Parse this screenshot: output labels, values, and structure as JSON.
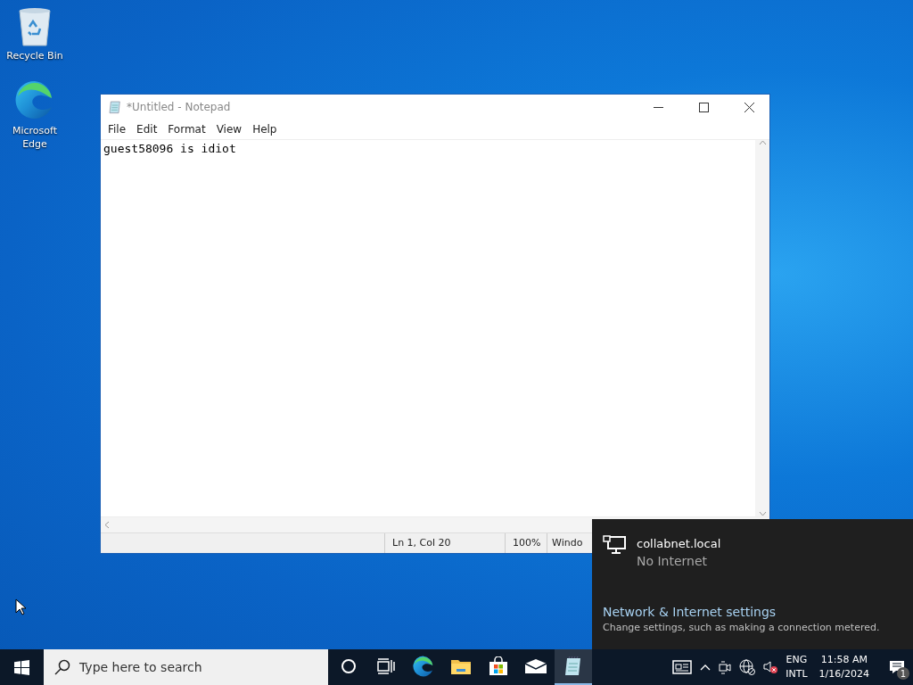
{
  "desktop_icons": [
    {
      "kind": "recycle-bin",
      "label": "Recycle Bin"
    },
    {
      "kind": "edge",
      "label": "Microsoft Edge"
    }
  ],
  "notepad": {
    "title": "*Untitled - Notepad",
    "menu": [
      "File",
      "Edit",
      "Format",
      "View",
      "Help"
    ],
    "text": "guest58096 is idiot",
    "status": [
      "Ln 1, Col 20",
      "100%",
      "Windo"
    ]
  },
  "network_flyout": {
    "network": "collabnet.local",
    "status": "No Internet",
    "settings_link": "Network & Internet settings",
    "settings_hint": "Change settings, such as making a connection metered."
  },
  "taskbar": {
    "search": {
      "placeholder": "Type here to search"
    },
    "apps": [
      {
        "kind": "cortana",
        "active": false
      },
      {
        "kind": "task-view",
        "active": false
      },
      {
        "kind": "edge",
        "active": false
      },
      {
        "kind": "explorer",
        "active": false
      },
      {
        "kind": "store",
        "active": false
      },
      {
        "kind": "mail",
        "active": false
      },
      {
        "kind": "notepad",
        "active": true
      }
    ],
    "language": [
      "ENG",
      "INTL"
    ],
    "time": "11:58 AM",
    "date": "1/16/2024",
    "notification_count": "1"
  }
}
